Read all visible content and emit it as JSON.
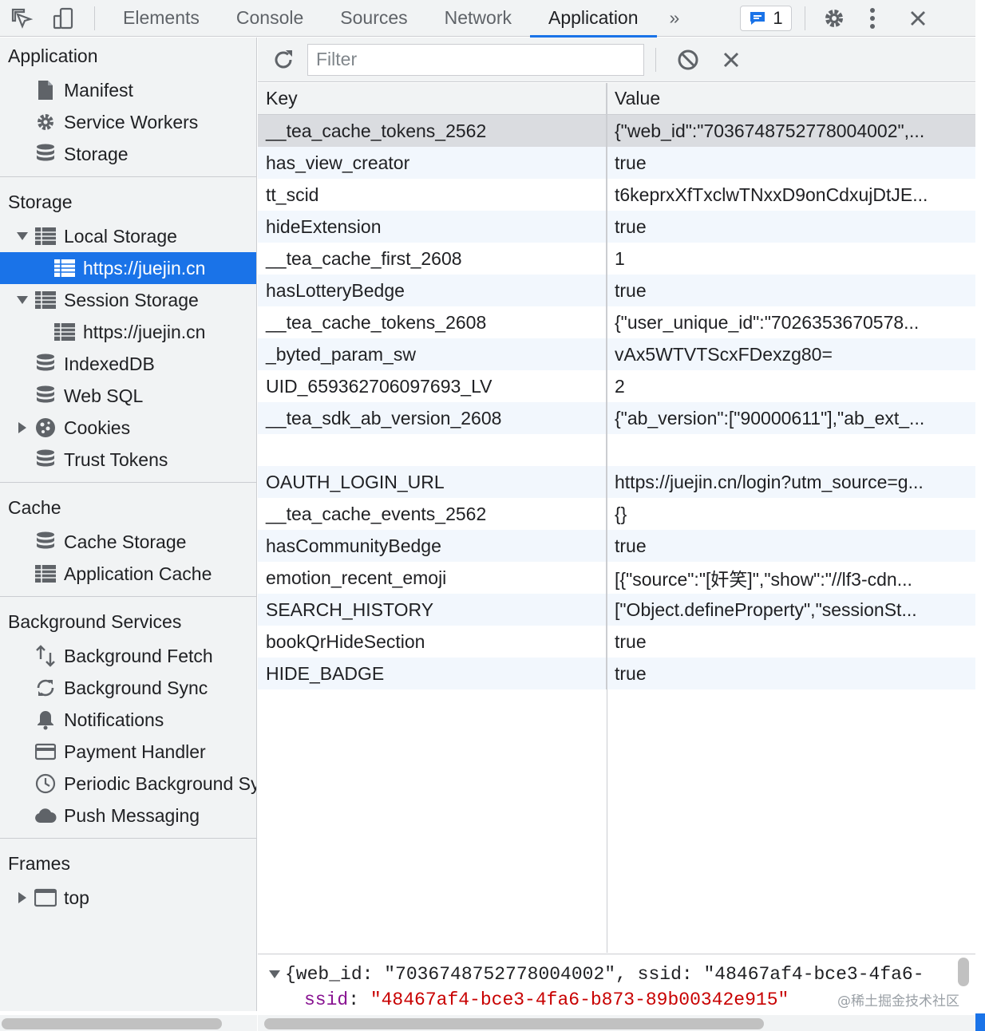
{
  "topbar": {
    "tabs": [
      {
        "label": "Elements",
        "active": false
      },
      {
        "label": "Console",
        "active": false
      },
      {
        "label": "Sources",
        "active": false
      },
      {
        "label": "Network",
        "active": false
      },
      {
        "label": "Application",
        "active": true
      }
    ],
    "more_label": "»",
    "issues_count": "1",
    "icons": [
      "inspect-icon",
      "device-toggle-icon",
      "issues-icon",
      "gear-icon",
      "kebab-menu-icon",
      "close-icon"
    ]
  },
  "sidebar": {
    "application": {
      "title": "Application",
      "items": [
        "Manifest",
        "Service Workers",
        "Storage"
      ]
    },
    "storage": {
      "title": "Storage",
      "local_storage": "Local Storage",
      "local_origin": "https://juejin.cn",
      "session_storage": "Session Storage",
      "session_origin": "https://juejin.cn",
      "indexeddb": "IndexedDB",
      "websql": "Web SQL",
      "cookies": "Cookies",
      "trust_tokens": "Trust Tokens"
    },
    "cache": {
      "title": "Cache",
      "items": [
        "Cache Storage",
        "Application Cache"
      ]
    },
    "background": {
      "title": "Background Services",
      "items": [
        "Background Fetch",
        "Background Sync",
        "Notifications",
        "Payment Handler",
        "Periodic Background Sync",
        "Push Messaging"
      ]
    },
    "frames": {
      "title": "Frames",
      "top": "top"
    }
  },
  "toolbar": {
    "filter_placeholder": "Filter"
  },
  "table": {
    "headers": {
      "key": "Key",
      "value": "Value"
    },
    "rows": [
      {
        "key": "__tea_cache_tokens_2562",
        "value": "{\"web_id\":\"7036748752778004002\",..."
      },
      {
        "key": "has_view_creator",
        "value": "true"
      },
      {
        "key": "tt_scid",
        "value": "t6keprxXfTxclwTNxxD9onCdxujDtJE..."
      },
      {
        "key": "hideExtension",
        "value": "true"
      },
      {
        "key": "__tea_cache_first_2608",
        "value": "1"
      },
      {
        "key": "hasLotteryBedge",
        "value": "true"
      },
      {
        "key": "__tea_cache_tokens_2608",
        "value": "{\"user_unique_id\":\"7026353670578..."
      },
      {
        "key": "_byted_param_sw",
        "value": "vAx5WTVTScxFDexzg80="
      },
      {
        "key": "UID_659362706097693_LV",
        "value": "2"
      },
      {
        "key": "__tea_sdk_ab_version_2608",
        "value": "{\"ab_version\":[\"90000611\"],\"ab_ext_..."
      },
      {
        "key": "",
        "value": ""
      },
      {
        "key": "OAUTH_LOGIN_URL",
        "value": "https://juejin.cn/login?utm_source=g..."
      },
      {
        "key": "__tea_cache_events_2562",
        "value": "{}"
      },
      {
        "key": "hasCommunityBedge",
        "value": "true"
      },
      {
        "key": "emotion_recent_emoji",
        "value": "[{\"source\":\"[奸笑]\",\"show\":\"//lf3-cdn..."
      },
      {
        "key": "SEARCH_HISTORY",
        "value": "[\"Object.defineProperty\",\"sessionSt..."
      },
      {
        "key": "bookQrHideSection",
        "value": "true"
      },
      {
        "key": "HIDE_BADGE",
        "value": "true"
      }
    ]
  },
  "preview": {
    "line1": "{web_id: \"7036748752778004002\", ssid: \"48467af4-bce3-4fa6-",
    "key2": "ssid",
    "colon2": ": ",
    "value2": "\"48467af4-bce3-4fa6-b873-89b00342e915\""
  },
  "watermark": "@稀土掘金技术社区",
  "colors": {
    "accent": "#1a73e8",
    "panel_bg": "#f1f3f4",
    "border": "#cbcdd1",
    "row_alt": "#f2f7fd",
    "row_selected": "#dadce0",
    "preview_key": "#881391",
    "preview_string": "#c80000"
  }
}
